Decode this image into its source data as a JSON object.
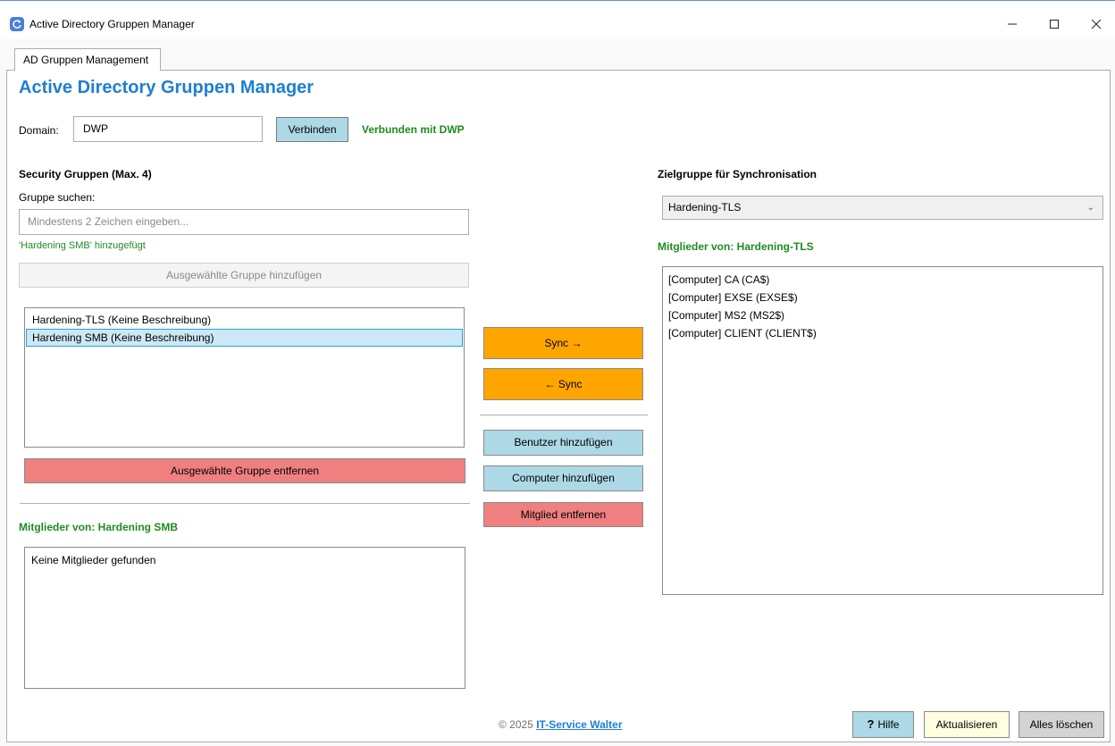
{
  "window": {
    "title": "Active Directory Gruppen Manager",
    "minimize_icon": "minimize-icon",
    "maximize_icon": "maximize-icon",
    "close_icon": "close-icon"
  },
  "tabs": [
    {
      "label": "AD Gruppen Management",
      "active": true
    }
  ],
  "main": {
    "heading": "Active Directory Gruppen Manager",
    "domain": {
      "label": "Domain:",
      "value": "DWP",
      "connect_label": "Verbinden",
      "status": "Verbunden mit DWP"
    },
    "security_groups": {
      "title": "Security Gruppen (Max. 4)",
      "search_label": "Gruppe suchen:",
      "search_placeholder": "Mindestens 2 Zeichen eingeben...",
      "message": "'Hardening SMB' hinzugefügt",
      "add_selected_label": "Ausgewählte Gruppe hinzufügen",
      "groups": [
        {
          "label": "Hardening-TLS (Keine Beschreibung)",
          "selected": false
        },
        {
          "label": "Hardening SMB (Keine Beschreibung)",
          "selected": true
        }
      ],
      "remove_selected_label": "Ausgewählte Gruppe entfernen"
    },
    "members_left": {
      "title": "Mitglieder von: Hardening SMB",
      "items": [
        "Keine Mitglieder gefunden"
      ]
    },
    "actions": {
      "sync_right": "Sync →",
      "sync_left": "← Sync",
      "add_user": "Benutzer hinzufügen",
      "add_computer": "Computer hinzufügen",
      "remove_member": "Mitglied entfernen"
    },
    "target": {
      "title": "Zielgruppe für Synchronisation",
      "selected": "Hardening-TLS",
      "members_title": "Mitglieder von: Hardening-TLS",
      "members": [
        "[Computer] CA (CA$)",
        "[Computer] EXSE (EXSE$)",
        "[Computer] MS2 (MS2$)",
        "[Computer] CLIENT (CLIENT$)"
      ]
    }
  },
  "footer": {
    "copyright": "© 2025 ",
    "link": "IT-Service Walter",
    "help_icon": "?",
    "help_label": "Hilfe",
    "refresh_label": "Aktualisieren",
    "clear_all_label": "Alles löschen"
  },
  "colors": {
    "accent_blue": "#1e7fd4",
    "status_green": "#1f8b1f",
    "sync_orange": "#ffa500",
    "action_blue": "#add8e6",
    "danger_red": "#f08080"
  }
}
